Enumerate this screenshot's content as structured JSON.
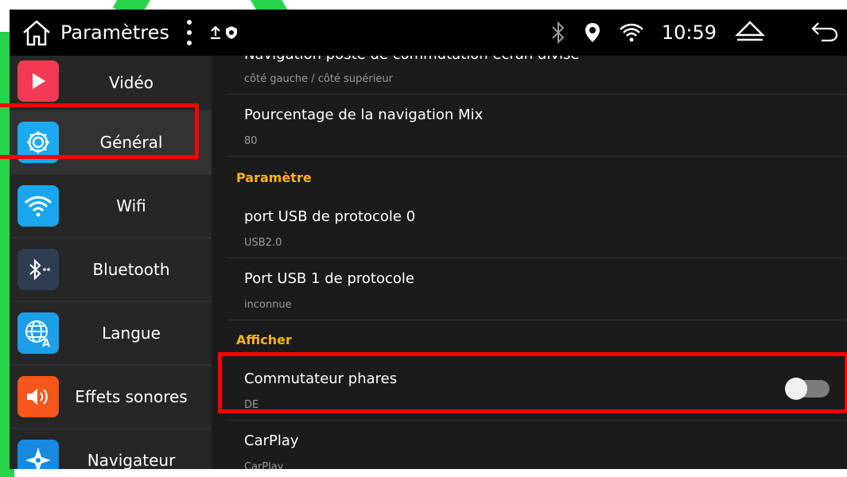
{
  "statusbar": {
    "title": "Paramètres",
    "time": "10:59",
    "icons": [
      "home-icon",
      "more-vert-icon",
      "upload-icon",
      "shield-icon",
      "bluetooth-icon",
      "location-icon",
      "wifi-icon",
      "eject-icon",
      "back-icon"
    ]
  },
  "sidebar": {
    "items": [
      {
        "label": "Vidéo",
        "icon": "play-icon",
        "color": "#f23a52"
      },
      {
        "label": "Général",
        "icon": "gear-icon",
        "color": "#1ba9f1"
      },
      {
        "label": "Wifi",
        "icon": "wifi-icon",
        "color": "#19a6ee"
      },
      {
        "label": "Bluetooth",
        "icon": "bluetooth-icon",
        "color": "#2e3d52"
      },
      {
        "label": "Langue",
        "icon": "globe-icon",
        "color": "#1c9ee8"
      },
      {
        "label": "Effets sonores",
        "icon": "speaker-icon",
        "color": "#f4561b"
      },
      {
        "label": "Navigateur",
        "icon": "compass-icon",
        "color": "#1889e0"
      }
    ]
  },
  "settings": {
    "row0": {
      "title": "Navigation poste de commutation écran divisé",
      "sub": "côté gauche / côté supérieur"
    },
    "row1": {
      "title": "Pourcentage de la navigation Mix",
      "sub": "80"
    },
    "section1": "Paramètre",
    "row2": {
      "title": "port USB de protocole 0",
      "sub": "USB2.0"
    },
    "row3": {
      "title": "Port USB 1 de protocole",
      "sub": "inconnue"
    },
    "section2": "Afficher",
    "row4": {
      "title": "Commutateur phares",
      "sub": "DE",
      "toggle_on": false
    },
    "row5": {
      "title": "CarPlay",
      "sub": "CarPlay"
    }
  },
  "colors": {
    "accent": "#ffb21c",
    "highlight": "#ff0000",
    "decoration": "#27d34a"
  }
}
